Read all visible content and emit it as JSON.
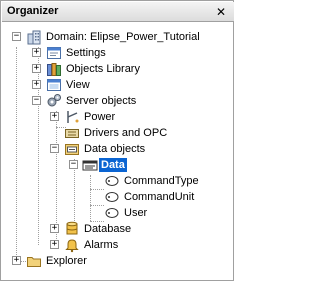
{
  "window": {
    "title": "Organizer",
    "close_glyph": "✕"
  },
  "tree": {
    "domain": "Domain: Elipse_Power_Tutorial",
    "settings": "Settings",
    "objects_library": "Objects Library",
    "view": "View",
    "server_objects": "Server objects",
    "power": "Power",
    "drivers_opc": "Drivers and OPC",
    "data_objects": "Data objects",
    "data": "Data",
    "command_type": "CommandType",
    "command_unit": "CommandUnit",
    "user": "User",
    "database": "Database",
    "alarms": "Alarms",
    "explorer": "Explorer"
  },
  "toggles": {
    "expanded": "−",
    "collapsed": "+"
  },
  "icons": {
    "domain": "building-icon",
    "settings": "settings-window-icon",
    "objects_library": "library-icon",
    "view": "view-window-icon",
    "server_objects": "gears-icon",
    "power": "power-icon",
    "drivers_opc": "driver-icon",
    "data_objects": "data-folder-icon",
    "data": "data-server-icon",
    "tag": "tag-icon",
    "database": "database-icon",
    "alarms": "bell-icon",
    "explorer": "folder-icon"
  },
  "colors": {
    "selection": "#0a64d2"
  }
}
